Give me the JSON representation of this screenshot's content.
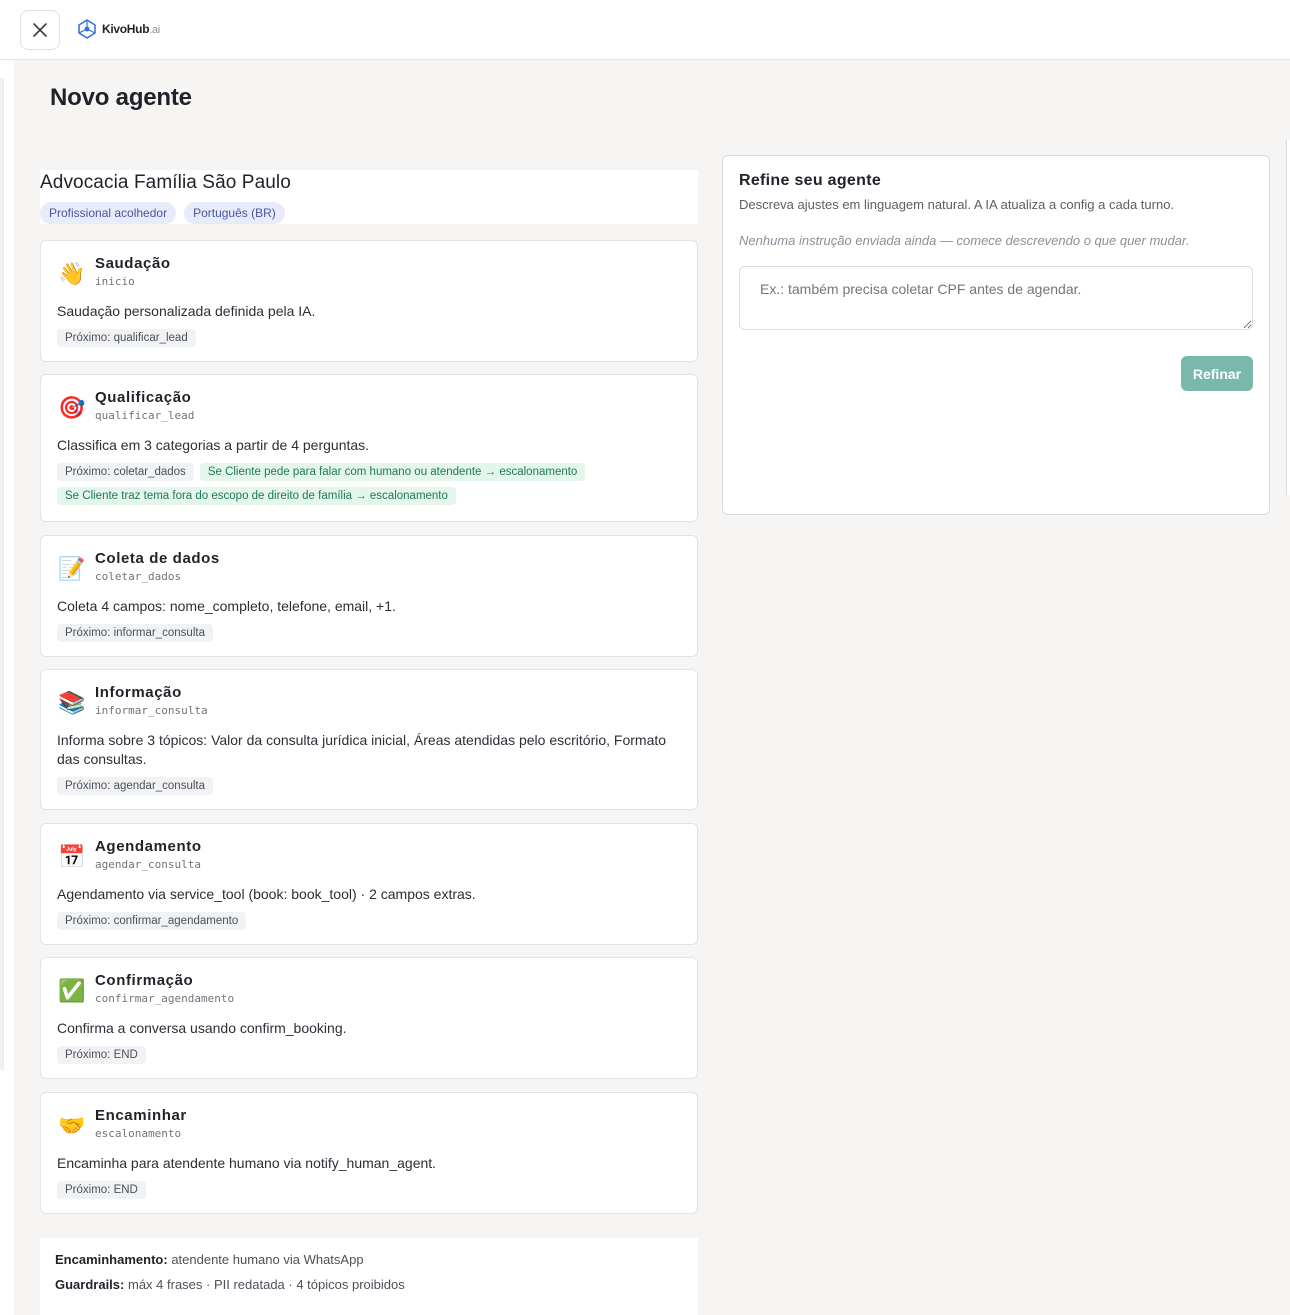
{
  "topbar": {
    "close_icon": "close-icon",
    "logo_icon": "network-logo-icon",
    "logo_text": "KivoHub",
    "logo_suffix": ".ai"
  },
  "page": {
    "title": "Novo agente"
  },
  "agent": {
    "name": "Advocacia Família São Paulo",
    "tags": [
      "Profissional acolhedor",
      "Português (BR)"
    ]
  },
  "steps": [
    {
      "emoji": "👋",
      "icon": "waving-hand-icon",
      "title": "Saudação",
      "id": "inicio",
      "description": "Saudação personalizada definida pela IA.",
      "chips": [
        {
          "text": "Próximo: qualificar_lead",
          "type": "next"
        }
      ]
    },
    {
      "emoji": "🎯",
      "icon": "target-icon",
      "title": "Qualificação",
      "id": "qualificar_lead",
      "description": "Classifica em 3 categorias a partir de 4 perguntas.",
      "chips": [
        {
          "text": "Próximo: coletar_dados",
          "type": "next"
        },
        {
          "text": "Se Cliente pede para falar com humano ou atendente → escalonamento",
          "type": "cond"
        },
        {
          "text": "Se Cliente traz tema fora do escopo de direito de família → escalonamento",
          "type": "cond"
        }
      ]
    },
    {
      "emoji": "📝",
      "icon": "memo-icon",
      "title": "Coleta de dados",
      "id": "coletar_dados",
      "description": "Coleta 4 campos: nome_completo, telefone, email, +1.",
      "chips": [
        {
          "text": "Próximo: informar_consulta",
          "type": "next"
        }
      ]
    },
    {
      "emoji": "📚",
      "icon": "books-icon",
      "title": "Informação",
      "id": "informar_consulta",
      "description": "Informa sobre 3 tópicos: Valor da consulta jurídica inicial, Áreas atendidas pelo escritório, Formato das consultas.",
      "chips": [
        {
          "text": "Próximo: agendar_consulta",
          "type": "next"
        }
      ]
    },
    {
      "emoji": "📅",
      "icon": "calendar-icon",
      "title": "Agendamento",
      "id": "agendar_consulta",
      "description": "Agendamento via service_tool (book: book_tool) · 2 campos extras.",
      "chips": [
        {
          "text": "Próximo: confirmar_agendamento",
          "type": "next"
        }
      ]
    },
    {
      "emoji": "✅",
      "icon": "check-mark-icon",
      "title": "Confirmação",
      "id": "confirmar_agendamento",
      "description": "Confirma a conversa usando confirm_booking.",
      "chips": [
        {
          "text": "Próximo: END",
          "type": "next"
        }
      ]
    },
    {
      "emoji": "🤝",
      "icon": "handshake-icon",
      "title": "Encaminhar",
      "id": "escalonamento",
      "description": "Encaminha para atendente humano via notify_human_agent.",
      "chips": [
        {
          "text": "Próximo: END",
          "type": "next"
        }
      ]
    }
  ],
  "summary": {
    "handoff_label": "Encaminhamento:",
    "handoff_value": "atendente humano via WhatsApp",
    "guardrails_label": "Guardrails:",
    "guardrails_value": "máx 4 frases · PII redatada · 4 tópicos proibidos"
  },
  "refine": {
    "title": "Refine seu agente",
    "subtitle": "Descreva ajustes em linguagem natural. A IA atualiza a config a cada turno.",
    "empty_state": "Nenhuma instrução enviada ainda — comece descrevendo o que quer mudar.",
    "input_placeholder": "Ex.: também precisa coletar CPF antes de agendar.",
    "input_value": "",
    "button_label": "Refinar",
    "button_color": "#79b8ad"
  }
}
